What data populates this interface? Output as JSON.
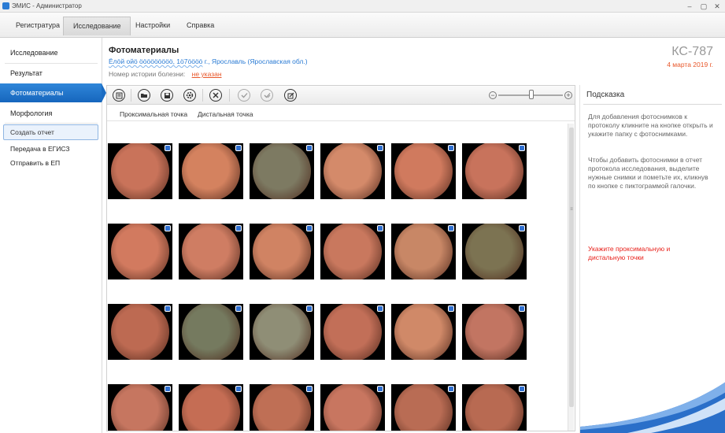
{
  "window": {
    "title": "ЭМИС - Администратор",
    "minimize": "–",
    "maximize": "▢",
    "close": "✕"
  },
  "menu": [
    {
      "label": "Регистратура",
      "active": false
    },
    {
      "label": "Исследование",
      "active": true
    },
    {
      "label": "Настройки",
      "active": false
    },
    {
      "label": "Справка",
      "active": false
    }
  ],
  "nav": {
    "items": [
      "Исследование",
      "Результат",
      "Фотоматериалы",
      "Морфология"
    ],
    "active_index": 2,
    "create_report": "Создать отчет",
    "links": [
      "Передача в ЕГИСЗ",
      "Отправить в ЕП"
    ]
  },
  "header": {
    "title": "Фотоматериалы",
    "patient_masked": "Ёлӧй ойӧ ӧӧӧӧӧӧӧӧӧ, 1ӧ7ӧӧӧӧ",
    "patient_city": "г., Ярославль (Ярославская обл.)",
    "history_label": "Номер истории болезни:",
    "history_value": "не указан",
    "case_id": "КС-787",
    "case_date": "4 марта 2019 г."
  },
  "toolbar": {
    "icons": [
      "report-icon",
      "open-folder-icon",
      "save-icon",
      "settings-icon",
      "delete-icon",
      "check-icon",
      "check-edit-icon",
      "edit-doc-icon"
    ],
    "zoom_minus": "−",
    "zoom_plus": "+",
    "zoom_level_fraction": 0.48
  },
  "point_tabs": [
    "Проксимальная точка",
    "Дистальная точка"
  ],
  "thumbnails": {
    "rows": 4,
    "cols": 6,
    "colors": [
      [
        "#c9735a",
        "#d4825f",
        "#7d7a62",
        "#d48a6a",
        "#d07a5e",
        "#c8735c"
      ],
      [
        "#d27a5f",
        "#cf7d63",
        "#d08363",
        "#c9785e",
        "#c88766",
        "#7c7352"
      ],
      [
        "#bd6a52",
        "#757a5f",
        "#8f8e76",
        "#c26f58",
        "#d08968",
        "#c27562"
      ],
      [
        "#c67660",
        "#c56d54",
        "#bf6f55",
        "#c87660",
        "#b96c54",
        "#b86a52"
      ]
    ]
  },
  "hint": {
    "title": "Подсказка",
    "p1": "Для добавления фотоснимков к протоколу кликните на кнопке открыть и укажите папку с фотоснимками.",
    "p2": "Чтобы добавить фотоснимки в отчет протокола исследования, выделите нужные снимки и пометьте их, кликнув по кнопке с пиктограммой галочки.",
    "warning": "Укажите проксимальную и дистальную точки"
  },
  "colors": {
    "accent": "#1a6cc3",
    "link": "#2a7bd4",
    "warning": "#e8201a",
    "date": "#e8572a"
  }
}
